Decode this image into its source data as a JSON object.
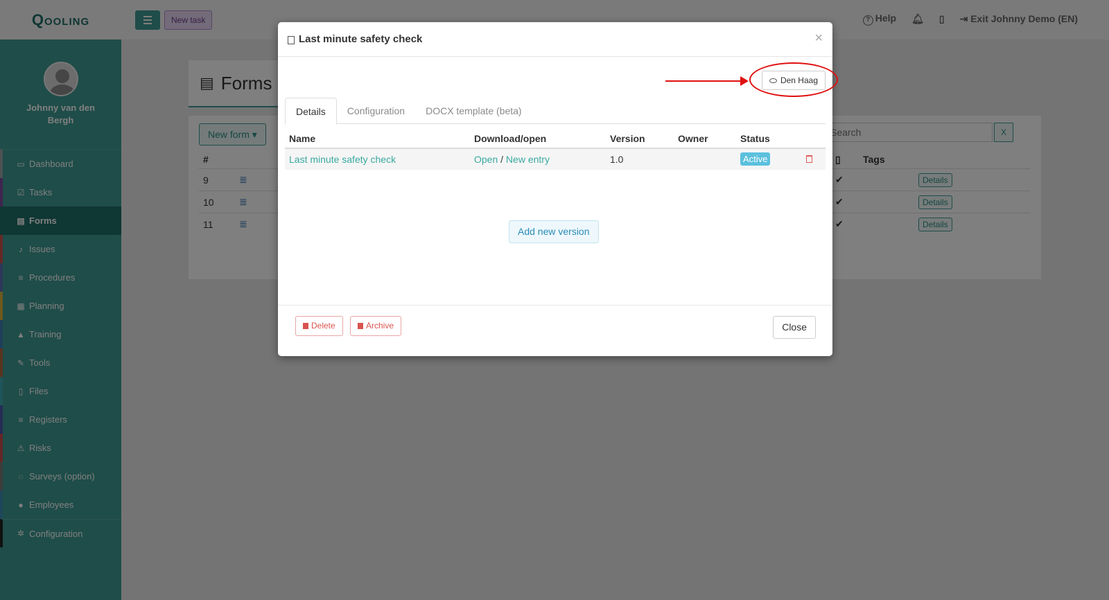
{
  "app": {
    "logo": "Qooling"
  },
  "topbar": {
    "new_task": "New task",
    "help": "Help",
    "exit": "Exit Johnny Demo (EN)"
  },
  "sidebar": {
    "user_name": "Johnny van den Bergh",
    "items": [
      {
        "label": "Dashboard",
        "icon": "monitor-icon",
        "color": "#9aa2a8"
      },
      {
        "label": "Tasks",
        "icon": "check-square-icon",
        "color": "#7d4b9e"
      },
      {
        "label": "Forms",
        "icon": "document-icon",
        "color": "#1f6e68"
      },
      {
        "label": "Issues",
        "icon": "bell-icon",
        "color": "#c9534f"
      },
      {
        "label": "Procedures",
        "icon": "list-icon",
        "color": "#5b6fb3"
      },
      {
        "label": "Planning",
        "icon": "calendar-icon",
        "color": "#d9b23a"
      },
      {
        "label": "Training",
        "icon": "graduation-cap-icon",
        "color": "#3e7fb3"
      },
      {
        "label": "Tools",
        "icon": "wrench-icon",
        "color": "#b36b3e"
      },
      {
        "label": "Files",
        "icon": "file-icon",
        "color": "#3ea9b3"
      },
      {
        "label": "Registers",
        "icon": "list-icon",
        "color": "#4b5aa8"
      },
      {
        "label": "Risks",
        "icon": "warning-icon",
        "color": "#c94f4f"
      },
      {
        "label": "Surveys (option)",
        "icon": "chat-icon",
        "color": "#7a7a7a"
      },
      {
        "label": "Employees",
        "icon": "users-icon",
        "color": "#3e8fb3"
      },
      {
        "label": "Configuration",
        "icon": "gear-icon",
        "color": "#222222"
      }
    ]
  },
  "page": {
    "title": "Forms",
    "new_form": "New form ▾",
    "search_placeholder": "Search",
    "search_clear": "X",
    "columns": {
      "num": "#",
      "tags": "Tags"
    },
    "rows": [
      {
        "num": "9",
        "details": "Details"
      },
      {
        "num": "10",
        "details": "Details"
      },
      {
        "num": "11",
        "details": "Details"
      }
    ]
  },
  "modal": {
    "title": "Last minute safety check",
    "close_x": "×",
    "location": "Den Haag",
    "tabs": [
      "Details",
      "Configuration",
      "DOCX template (beta)"
    ],
    "table": {
      "headers": {
        "name": "Name",
        "download": "Download/open",
        "version": "Version",
        "owner": "Owner",
        "status": "Status"
      },
      "row": {
        "name": "Last minute safety check",
        "open": "Open",
        "sep": "/",
        "new_entry": "New entry",
        "version": "1.0",
        "owner": "",
        "status": "Active"
      }
    },
    "add_version": "Add new version",
    "delete": "Delete",
    "archive": "Archive",
    "close": "Close"
  },
  "colors": {
    "accent": "#3f9a93",
    "annotation": "#e01010",
    "status_active": "#5bc0de"
  }
}
